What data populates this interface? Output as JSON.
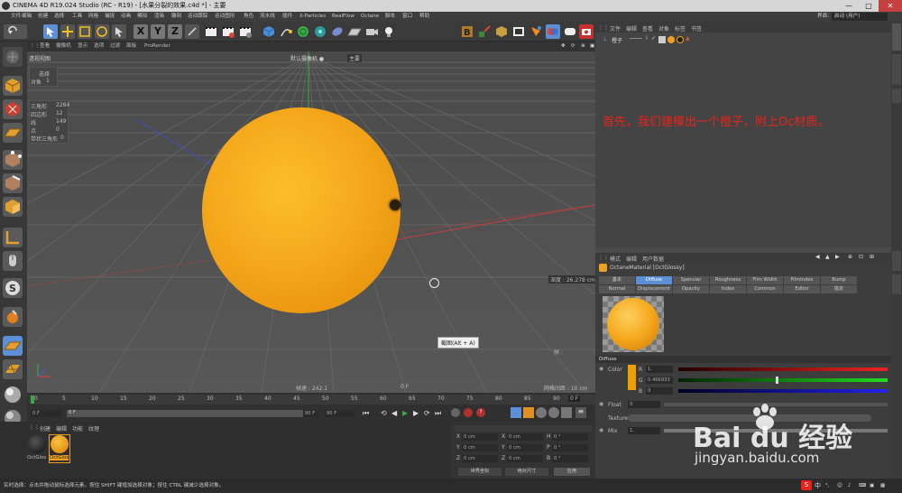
{
  "window": {
    "title": "CINEMA 4D R19.024 Studio (RC - R19) - [水果分裂的效果.c4d *] - 主要",
    "controls": [
      "—",
      "□",
      "✕"
    ]
  },
  "menubar": {
    "items": [
      "文件",
      "编辑",
      "创建",
      "选择",
      "工具",
      "网格",
      "捕捉",
      "动画",
      "模拟",
      "渲染",
      "雕刻",
      "运动跟踪",
      "运动图形",
      "角色",
      "流水线",
      "插件",
      "X-Particles",
      "RealFlow",
      "Octane",
      "脚本",
      "窗口",
      "帮助"
    ],
    "interface_label": "界面:",
    "interface_value": "启动 (用户)"
  },
  "viewport": {
    "menu": [
      "查看",
      "摄像机",
      "显示",
      "选项",
      "过滤",
      "面板",
      "ProRender"
    ],
    "view_name": "透视视图",
    "camera_label": "默认摄像机 ●",
    "hud_label": "主要",
    "selected_label": "选择",
    "object_count_label": "对象",
    "object_count": "1",
    "stats": [
      {
        "k": "三角形",
        "v": "2284"
      },
      {
        "k": "四边形",
        "v": "12"
      },
      {
        "k": "线",
        "v": "149"
      },
      {
        "k": "点",
        "v": "0"
      },
      {
        "k": "带状三角形",
        "v": "0"
      }
    ],
    "grid_spacing": "网格间距 : 10 cm",
    "depth_label": "深度 : 26.278 cm",
    "speed_label": "帧速 : 242.1",
    "tooltip": "截图(Alt + A)",
    "frame_indicator": "0 F",
    "axes": {
      "x": "X",
      "y": "Y",
      "z": "Z"
    },
    "top_right_icons": [
      "move",
      "rotate",
      "zoom",
      "expand"
    ]
  },
  "timeline": {
    "ticks": [
      "0",
      "5",
      "10",
      "15",
      "20",
      "25",
      "30",
      "35",
      "40",
      "45",
      "50",
      "55",
      "60",
      "65",
      "70",
      "75",
      "80",
      "85",
      "90"
    ],
    "current_frame": "0 F",
    "start_frame": "0 F",
    "end_frame": "90 F",
    "preview_end": "90 F",
    "time_display": "0 F"
  },
  "material_manager": {
    "menu": [
      "创建",
      "编辑",
      "功能",
      "纹理"
    ],
    "materials": [
      {
        "name": "OctGlos",
        "color": "#1a1a1a"
      },
      {
        "name": "OctGlos",
        "color": "#f0a020"
      }
    ]
  },
  "coords": {
    "rows": [
      {
        "a": "X",
        "av": "0 cm",
        "b": "X",
        "bv": "0 cm",
        "c": "H",
        "cv": "0 °"
      },
      {
        "a": "Y",
        "av": "0 cm",
        "b": "Y",
        "bv": "0 cm",
        "c": "P",
        "cv": "0 °"
      },
      {
        "a": "Z",
        "av": "0 cm",
        "b": "Z",
        "bv": "0 cm",
        "c": "B",
        "cv": "0 °"
      }
    ],
    "dropdown1": "世界坐标",
    "dropdown2": "绝对尺寸",
    "apply": "应用"
  },
  "status": {
    "text": "实时选择：点击并拖动鼠标选择元素。按住 SHIFT 键增加选择对象；按住 CTRL 键减少选择对象。"
  },
  "object_manager": {
    "menu": [
      "文件",
      "编辑",
      "查看",
      "对象",
      "标签",
      "书签"
    ],
    "objects": [
      {
        "name": "橙子"
      }
    ]
  },
  "annotation": "首先，我们建模出一个橙子，附上Oc材质。",
  "attributes": {
    "menu": [
      "模式",
      "编辑",
      "用户数据"
    ],
    "material_title": "OctaneMaterial [OctGlossy]",
    "tabs_row1": [
      "基本",
      "Diffuse",
      "Specular",
      "Roughness",
      "Film Width",
      "FilmIndex",
      "Bump"
    ],
    "tabs_row2": [
      "Normal",
      "Displacement",
      "Opacity",
      "Index",
      "Common",
      "Editor",
      "指定"
    ],
    "active_tab": "Diffuse",
    "section": "Diffuse",
    "color_label": "Color",
    "r_label": "R",
    "r_value": "1.",
    "g_label": "G",
    "g_value": "0.466933",
    "b_label": "B",
    "b_value": "0",
    "float_label": "Float",
    "float_value": "0",
    "texture_label": "Texture",
    "mix_label": "Mix",
    "mix_value": "1.",
    "diffuse_color": "#f0a000"
  },
  "watermark": {
    "logo": "Bai du 经验",
    "url": "jingyan.baidu.com"
  },
  "tray": {
    "ime": "中"
  },
  "colors": {
    "orange": "#f5a81c",
    "annotation_red": "#e8231a",
    "accent_blue": "#5b8fd6"
  }
}
